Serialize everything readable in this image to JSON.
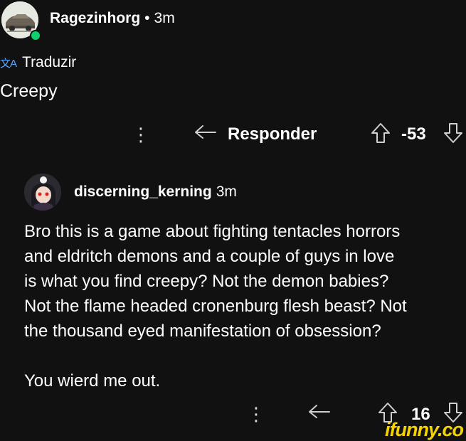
{
  "comment": {
    "username": "Ragezinhorg",
    "separator": "•",
    "time": "3m",
    "translate_label": "Traduzir",
    "translate_icon": "文A",
    "text": "Creepy",
    "more_icon": "⋮",
    "reply_label": "Responder",
    "vote_count": "-53"
  },
  "reply": {
    "username": "discerning_kerning",
    "time": "3m",
    "lines": [
      "Bro this is a game about fighting tentacles horrors",
      "and eldritch demons and a couple of guys in love",
      "is what you find creepy? Not the demon babies?",
      "Not the flame headed cronenburg flesh beast? Not",
      "the thousand eyed manifestation of obsession?"
    ],
    "closing_line": "You wierd me out.",
    "more_icon": "⋮",
    "vote_count": "16"
  },
  "watermark": "ifunny.co",
  "colors": {
    "background": "#111112",
    "online": "#0bd36a",
    "translate": "#5aa7ff",
    "watermark": "#f5d300"
  }
}
